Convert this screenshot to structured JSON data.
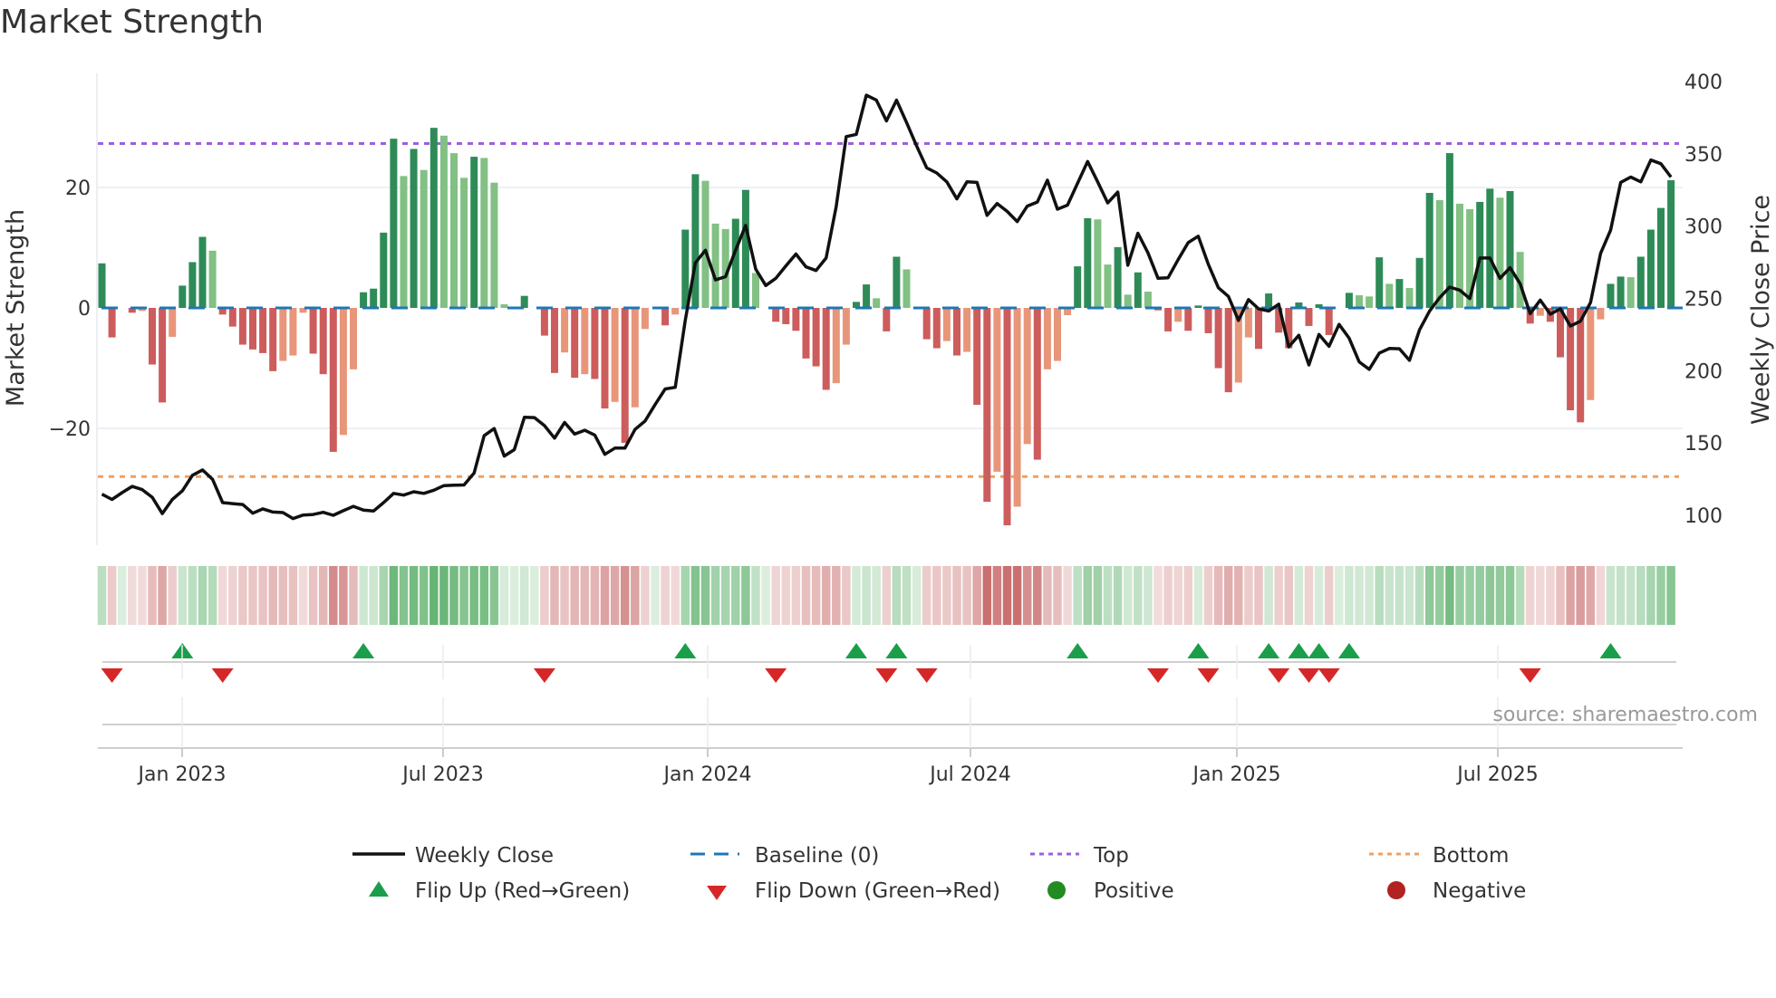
{
  "title": "Market Strength",
  "source": "source: sharemaestro.com",
  "legend": {
    "weekly_close": "Weekly Close",
    "baseline": "Baseline (0)",
    "top": "Top",
    "bottom": "Bottom",
    "flip_up": "Flip Up (Red→Green)",
    "flip_down": "Flip Down (Green→Red)",
    "positive": "Positive",
    "negative": "Negative"
  },
  "colors": {
    "pos_strong": "#2e8b57",
    "pos_weak": "#82c084",
    "neg_strong": "#cd5c5c",
    "neg_weak": "#e8967a",
    "baseline": "#1f77b4",
    "top": "#9b5fe0",
    "bottom": "#f0a060",
    "line": "#111111",
    "flip_up": "#1a9e4a",
    "flip_down": "#d62728",
    "positive": "#228b22",
    "negative": "#b22222"
  },
  "chart_data": {
    "type": "bar+line",
    "title": "Market Strength",
    "ylabel": "Market Strength",
    "y2label": "Weekly Close Price",
    "ylim": [
      -39,
      41
    ],
    "y2lim": [
      75,
      420
    ],
    "yticks": [
      "20",
      "0",
      "−20"
    ],
    "ytick_values": [
      20,
      0,
      -20
    ],
    "y2ticks": [
      "400",
      "350",
      "300",
      "250",
      "200",
      "150",
      "100"
    ],
    "y2tick_values": [
      400,
      350,
      300,
      250,
      200,
      150,
      100
    ],
    "xticks": [
      "Jan 2023",
      "Jul 2023",
      "Jan 2024",
      "Jul 2024",
      "Jan 2025",
      "Jul 2025"
    ],
    "top_level": 27.3,
    "bottom_level": -28,
    "strength": [
      7.4,
      -4.9,
      0,
      -0.8,
      -0.5,
      -9.4,
      -15.7,
      -4.8,
      3.7,
      7.6,
      11.8,
      9.5,
      -1.1,
      -3.1,
      -6.1,
      -6.9,
      -7.5,
      -10.5,
      -8.8,
      -7.9,
      -0.8,
      -7.6,
      -11,
      -23.9,
      -21.1,
      -10.2,
      2.6,
      3.2,
      12.5,
      28.1,
      21.9,
      26.4,
      22.9,
      29.9,
      28.6,
      25.7,
      21.6,
      25.1,
      24.9,
      20.8,
      0.6,
      0,
      2.0,
      0,
      -4.6,
      -10.8,
      -7.4,
      -11.6,
      -11,
      -11.8,
      -16.7,
      -15.6,
      -22.4,
      -16.5,
      -3.5,
      0,
      -2.9,
      -1.1,
      13.0,
      22.2,
      21.1,
      14.0,
      13.1,
      14.8,
      19.6,
      5.8,
      0,
      -2.3,
      -2.7,
      -3.8,
      -8.4,
      -9.7,
      -13.6,
      -12.5,
      -6.1,
      1.0,
      3.9,
      1.6,
      -3.9,
      8.5,
      6.4,
      0.2,
      -5.2,
      -6.7,
      -5.5,
      -7.9,
      -7.3,
      -16.1,
      -32.2,
      -27.2,
      -36.1,
      -33,
      -22.6,
      -25.2,
      -10.2,
      -8.8,
      -1.2,
      6.9,
      14.9,
      14.7,
      7.2,
      10.1,
      2.2,
      5.9,
      2.7,
      -0.4,
      -3.9,
      -2.3,
      -3.8,
      0.4,
      -4.2,
      -10.0,
      -14.0,
      -12.4,
      -4.9,
      -6.8,
      2.4,
      -4.1,
      -6.7,
      0.9,
      -3.0,
      0.6,
      -4.5,
      0,
      2.5,
      2.1,
      1.9,
      8.4,
      4.0,
      4.8,
      3.3,
      8.3,
      19.1,
      17.9,
      25.7,
      17.3,
      16.4,
      17.6,
      19.8,
      18.3,
      19.4,
      9.3,
      -2.6,
      -1.3,
      -2.3,
      -8.2,
      -17.0,
      -19.0,
      -15.3,
      -1.9,
      4.0,
      5.2,
      5.1,
      8.5,
      13.0,
      16.6,
      21.2
    ],
    "weekly_close": [
      114.6,
      111,
      115.7,
      120,
      117.8,
      112.5,
      101.2,
      111,
      117,
      127.7,
      131.4,
      124.9,
      108.8,
      108.1,
      107.5,
      101.5,
      104.5,
      102.3,
      101.9,
      97.8,
      100.2,
      100.6,
      102.1,
      100,
      103.2,
      106.2,
      103.6,
      103,
      108.8,
      115.2,
      114,
      116.3,
      115.2,
      117.4,
      120.6,
      120.8,
      121,
      129.2,
      155.1,
      160,
      141,
      145.4,
      167.8,
      167.6,
      162,
      153.4,
      164.2,
      156.2,
      158.8,
      155.5,
      142.2,
      146.5,
      146.5,
      159.4,
      165.2,
      176.6,
      187.4,
      188.5,
      235,
      274.6,
      283.3,
      262.8,
      265,
      283.3,
      300.5,
      270.3,
      258.9,
      263.9,
      272.5,
      280.7,
      271.8,
      269.3,
      277.9,
      313.4,
      361.9,
      363.4,
      390.5,
      387.1,
      372.7,
      387.1,
      371.6,
      355.4,
      340.3,
      336.7,
      330.6,
      318.8,
      330.6,
      330.2,
      307.4,
      315.6,
      310.2,
      303.1,
      313.8,
      316.6,
      331.7,
      311.7,
      314.5,
      329.6,
      344.7,
      330.6,
      316,
      323.5,
      272.9,
      295.1,
      281.5,
      263.9,
      264.3,
      276.8,
      288.6,
      293,
      273.6,
      257.4,
      251.4,
      234.8,
      249.2,
      242.8,
      241.3,
      246,
      216.5,
      224.5,
      204,
      225.1,
      216.9,
      232,
      222.5,
      206.1,
      201,
      212.2,
      215.4,
      215.2,
      207.2,
      228.3,
      241.3,
      250.5,
      257.8,
      255.7,
      249.9,
      277.9,
      277.9,
      263.9,
      271.2,
      260.2,
      239.5,
      248.8,
      239.1,
      242.8,
      230.9,
      234.2,
      247.1,
      281.1,
      297.3,
      330.2,
      333.9,
      330.6,
      345.7,
      343.1,
      333.9
    ],
    "flip_up_weeks": [
      9,
      27,
      59,
      76,
      80,
      98,
      110,
      117,
      120,
      122,
      125,
      151
    ],
    "flip_down_weeks": [
      2,
      13,
      45,
      68,
      79,
      83,
      106,
      111,
      118,
      121,
      123,
      143
    ],
    "legend_position": "bottom"
  }
}
